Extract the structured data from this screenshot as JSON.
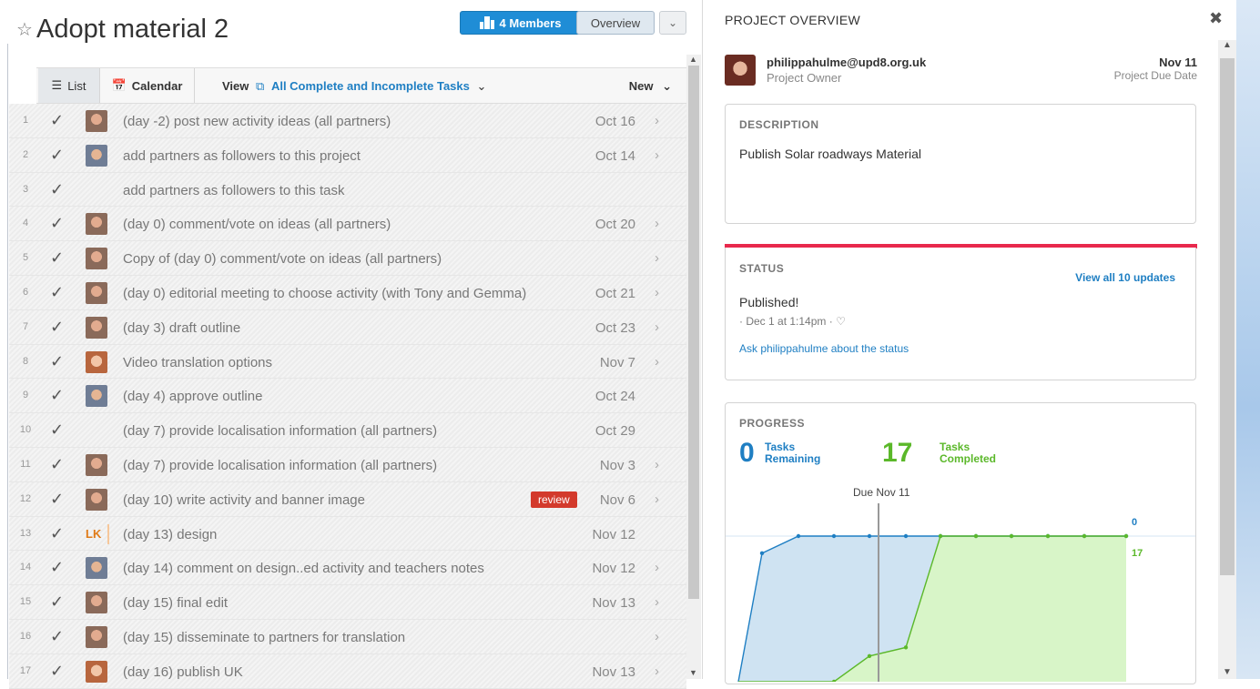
{
  "project": {
    "title": "Adopt material 2",
    "members_label": "4 Members",
    "overview_label": "Overview"
  },
  "toolbar": {
    "list_label": "List",
    "calendar_label": "Calendar",
    "view_label": "View",
    "view_filter": "All Complete and Incomplete Tasks",
    "new_label": "New"
  },
  "tasks": [
    {
      "num": "1",
      "name": "(day -2) post new activity ideas (all partners)",
      "date": "Oct 16",
      "avatar": "woman-dark",
      "chevron": true
    },
    {
      "num": "2",
      "name": "add partners as followers to this project",
      "date": "Oct 14",
      "avatar": "man",
      "chevron": true
    },
    {
      "num": "3",
      "name": "add partners as followers to this task",
      "date": "",
      "avatar": "",
      "chevron": false
    },
    {
      "num": "4",
      "name": "(day 0) comment/vote on ideas (all partners)",
      "date": "Oct 20",
      "avatar": "woman-dark",
      "chevron": true
    },
    {
      "num": "5",
      "name": "Copy of (day 0) comment/vote on ideas (all partners)",
      "date": "",
      "avatar": "woman-dark",
      "chevron": true
    },
    {
      "num": "6",
      "name": "(day 0) editorial meeting to choose activity (with Tony and Gemma)",
      "date": "Oct 21",
      "avatar": "woman-dark",
      "chevron": true
    },
    {
      "num": "7",
      "name": "(day 3) draft outline",
      "date": "Oct 23",
      "avatar": "woman-dark",
      "chevron": true
    },
    {
      "num": "8",
      "name": "Video translation options",
      "date": "Nov 7",
      "avatar": "woman-light",
      "chevron": true
    },
    {
      "num": "9",
      "name": "(day 4) approve outline",
      "date": "Oct 24",
      "avatar": "man",
      "chevron": false
    },
    {
      "num": "10",
      "name": "(day 7) provide localisation information (all partners)",
      "date": "Oct 29",
      "avatar": "",
      "chevron": false
    },
    {
      "num": "11",
      "name": "(day 7) provide localisation information (all partners)",
      "date": "Nov 3",
      "avatar": "woman-dark",
      "chevron": true
    },
    {
      "num": "12",
      "name": "(day 10) write activity and banner image",
      "date": "Nov 6",
      "avatar": "woman-dark",
      "chevron": true,
      "tag": "review"
    },
    {
      "num": "13",
      "name": "(day 13) design",
      "date": "Nov 12",
      "avatar": "",
      "initials": "LK",
      "chevron": false
    },
    {
      "num": "14",
      "name": "(day 14) comment on design..ed activity and teachers notes",
      "date": "Nov 12",
      "avatar": "man",
      "chevron": true
    },
    {
      "num": "15",
      "name": "(day 15) final edit",
      "date": "Nov 13",
      "avatar": "woman-dark",
      "chevron": true
    },
    {
      "num": "16",
      "name": "(day 15) disseminate to partners for translation",
      "date": "",
      "avatar": "woman-dark",
      "chevron": true
    },
    {
      "num": "17",
      "name": "(day 16) publish UK",
      "date": "Nov 13",
      "avatar": "woman-light",
      "chevron": true
    }
  ],
  "overview": {
    "heading": "PROJECT OVERVIEW",
    "owner_email": "philippahulme@upd8.org.uk",
    "owner_role": "Project Owner",
    "due_date": "Nov 11",
    "due_label": "Project Due Date",
    "description_heading": "DESCRIPTION",
    "description_text": "Publish Solar roadways Material",
    "status_heading": "STATUS",
    "status_link": "View all 10 updates",
    "status_text": "Published!",
    "status_meta": "Dec 1 at 1:14pm",
    "status_ask": "Ask philippahulme about the status",
    "progress_heading": "PROGRESS",
    "remaining_count": "0",
    "remaining_label": "Tasks Remaining",
    "completed_count": "17",
    "completed_label": "Tasks Completed",
    "due_marker": "Due Nov 11",
    "remaining_end_label": "0",
    "completed_end_label": "17"
  },
  "colors": {
    "accent": "#1f8dd6",
    "status_bar": "#e8294d",
    "remaining": "#1f7fc3",
    "completed": "#5bb82a",
    "review_tag": "#d33a2c"
  },
  "chart_data": {
    "type": "area",
    "xlabel": "",
    "ylabel": "",
    "series": [
      {
        "values": [
          0,
          15,
          17,
          17,
          17,
          17,
          17,
          17,
          17,
          17,
          17,
          17
        ]
      },
      {
        "values": [
          0,
          0,
          0,
          0,
          3,
          4,
          17,
          17,
          17,
          17,
          17,
          17
        ]
      }
    ],
    "annotations": [
      "Due Nov 11"
    ],
    "end_labels": [
      "0",
      "17"
    ]
  }
}
